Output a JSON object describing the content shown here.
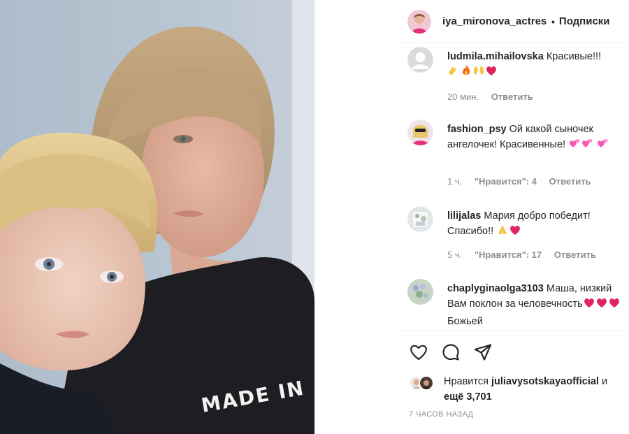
{
  "post": {
    "author": "iya_mironova_actress",
    "separator": "•",
    "follow_label": "Подписки",
    "photo_shirt_text": "MADE IN"
  },
  "comments": [
    {
      "author": "ludmila.mihailovska",
      "text": "Красивые!!!",
      "emojis": [
        "clapping-hands",
        "fire",
        "raising-hands",
        "red-heart"
      ],
      "time": "20 мин.",
      "likes": "",
      "reply_label": "Ответить"
    },
    {
      "author": "fashion_psy",
      "text": "Ой какой сыночек ангелочек! Красивенные!",
      "emojis": [
        "pink-hearts",
        "pink-hearts",
        "pink-hearts"
      ],
      "time": "1 ч.",
      "likes": "\"Нравится\": 4",
      "reply_label": "Ответить"
    },
    {
      "author": "lilijalas",
      "text": "Мария добро победит! Спасибо!!",
      "emojis": [
        "folded-hands",
        "red-heart"
      ],
      "time": "5 ч.",
      "likes": "\"Нравится\": 17",
      "reply_label": "Ответить"
    },
    {
      "author": "chaplyginaolga3103",
      "text": "Маша, низкий Вам поклон за человечность",
      "text_after": "Божьей",
      "emojis": [
        "red-heart",
        "red-heart",
        "red-heart"
      ],
      "time": "",
      "likes": "",
      "reply_label": ""
    }
  ],
  "actions": {
    "like_icon": "heart-icon",
    "comment_icon": "comment-bubble-icon",
    "share_icon": "paper-plane-icon"
  },
  "likes": {
    "prefix": "Нравится",
    "user": "juliavysotskayaofficial",
    "and": "и",
    "others": "ещё 3,701"
  },
  "timestamp": "7 часов назад",
  "colors": {
    "text": "#262626",
    "secondary": "#8e8e8e",
    "divider": "#efefef",
    "heart": "#e0245e"
  }
}
